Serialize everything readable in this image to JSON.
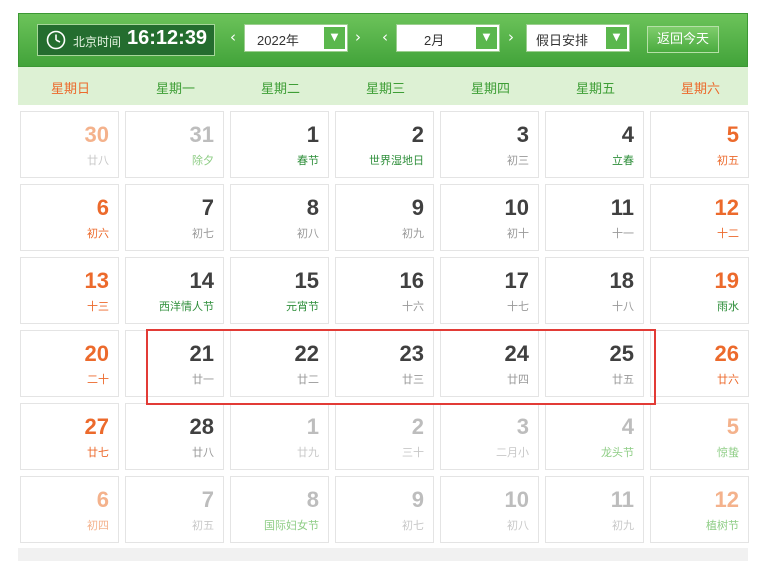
{
  "toolbar": {
    "clock_label": "北京时间",
    "time": "16:12:39",
    "prev_arrow": "‹",
    "next_arrow": "›",
    "year_value": "2022年",
    "month_value": "2月",
    "holiday_value": "假日安排",
    "dropdown_glyph": "▼",
    "today_button": "返回今天"
  },
  "weekdays": [
    "星期日",
    "星期一",
    "星期二",
    "星期三",
    "星期四",
    "星期五",
    "星期六"
  ],
  "colors": {
    "weekend": "#ec6a2c",
    "weekend_faded": "#f4b28c",
    "weekday": "#404040",
    "weekday_faded": "#bdbdbd",
    "lunar": "#999999",
    "lunar_faded": "#c8c8c8",
    "festival": "#2f8f3b",
    "festival_faded": "#8ecd85",
    "header_weekday": "#3e9e36",
    "header_weekend": "#ec6a2c"
  },
  "weeks": [
    [
      {
        "day": "30",
        "sub": "廿八",
        "type": "weekend",
        "kind": "lunar",
        "faded": true
      },
      {
        "day": "31",
        "sub": "除夕",
        "type": "weekday",
        "kind": "festival",
        "faded": true
      },
      {
        "day": "1",
        "sub": "春节",
        "type": "weekday",
        "kind": "festival",
        "faded": false
      },
      {
        "day": "2",
        "sub": "世界湿地日",
        "type": "weekday",
        "kind": "festival",
        "faded": false
      },
      {
        "day": "3",
        "sub": "初三",
        "type": "weekday",
        "kind": "lunar",
        "faded": false
      },
      {
        "day": "4",
        "sub": "立春",
        "type": "weekday",
        "kind": "festival",
        "faded": false
      },
      {
        "day": "5",
        "sub": "初五",
        "type": "weekend",
        "kind": "weekendsub",
        "faded": false
      }
    ],
    [
      {
        "day": "6",
        "sub": "初六",
        "type": "weekend",
        "kind": "weekendsub",
        "faded": false
      },
      {
        "day": "7",
        "sub": "初七",
        "type": "weekday",
        "kind": "lunar",
        "faded": false
      },
      {
        "day": "8",
        "sub": "初八",
        "type": "weekday",
        "kind": "lunar",
        "faded": false
      },
      {
        "day": "9",
        "sub": "初九",
        "type": "weekday",
        "kind": "lunar",
        "faded": false
      },
      {
        "day": "10",
        "sub": "初十",
        "type": "weekday",
        "kind": "lunar",
        "faded": false
      },
      {
        "day": "11",
        "sub": "十一",
        "type": "weekday",
        "kind": "lunar",
        "faded": false
      },
      {
        "day": "12",
        "sub": "十二",
        "type": "weekend",
        "kind": "weekendsub",
        "faded": false
      }
    ],
    [
      {
        "day": "13",
        "sub": "十三",
        "type": "weekend",
        "kind": "weekendsub",
        "faded": false
      },
      {
        "day": "14",
        "sub": "西洋情人节",
        "type": "weekday",
        "kind": "festival",
        "faded": false
      },
      {
        "day": "15",
        "sub": "元宵节",
        "type": "weekday",
        "kind": "festival",
        "faded": false
      },
      {
        "day": "16",
        "sub": "十六",
        "type": "weekday",
        "kind": "lunar",
        "faded": false
      },
      {
        "day": "17",
        "sub": "十七",
        "type": "weekday",
        "kind": "lunar",
        "faded": false
      },
      {
        "day": "18",
        "sub": "十八",
        "type": "weekday",
        "kind": "lunar",
        "faded": false
      },
      {
        "day": "19",
        "sub": "雨水",
        "type": "weekend",
        "kind": "festival",
        "faded": false
      }
    ],
    [
      {
        "day": "20",
        "sub": "二十",
        "type": "weekend",
        "kind": "weekendsub",
        "faded": false
      },
      {
        "day": "21",
        "sub": "廿一",
        "type": "weekday",
        "kind": "lunar",
        "faded": false
      },
      {
        "day": "22",
        "sub": "廿二",
        "type": "weekday",
        "kind": "lunar",
        "faded": false
      },
      {
        "day": "23",
        "sub": "廿三",
        "type": "weekday",
        "kind": "lunar",
        "faded": false
      },
      {
        "day": "24",
        "sub": "廿四",
        "type": "weekday",
        "kind": "lunar",
        "faded": false
      },
      {
        "day": "25",
        "sub": "廿五",
        "type": "weekday",
        "kind": "lunar",
        "faded": false
      },
      {
        "day": "26",
        "sub": "廿六",
        "type": "weekend",
        "kind": "weekendsub",
        "faded": false
      }
    ],
    [
      {
        "day": "27",
        "sub": "廿七",
        "type": "weekend",
        "kind": "weekendsub",
        "faded": false
      },
      {
        "day": "28",
        "sub": "廿八",
        "type": "weekday",
        "kind": "lunar",
        "faded": false
      },
      {
        "day": "1",
        "sub": "廿九",
        "type": "weekday",
        "kind": "lunar",
        "faded": true
      },
      {
        "day": "2",
        "sub": "三十",
        "type": "weekday",
        "kind": "lunar",
        "faded": true
      },
      {
        "day": "3",
        "sub": "二月小",
        "type": "weekday",
        "kind": "lunar",
        "faded": true
      },
      {
        "day": "4",
        "sub": "龙头节",
        "type": "weekday",
        "kind": "festival",
        "faded": true
      },
      {
        "day": "5",
        "sub": "惊蛰",
        "type": "weekend",
        "kind": "festival",
        "faded": true
      }
    ],
    [
      {
        "day": "6",
        "sub": "初四",
        "type": "weekend",
        "kind": "weekendsub",
        "faded": true
      },
      {
        "day": "7",
        "sub": "初五",
        "type": "weekday",
        "kind": "lunar",
        "faded": true
      },
      {
        "day": "8",
        "sub": "国际妇女节",
        "type": "weekday",
        "kind": "festival",
        "faded": true
      },
      {
        "day": "9",
        "sub": "初七",
        "type": "weekday",
        "kind": "lunar",
        "faded": true
      },
      {
        "day": "10",
        "sub": "初八",
        "type": "weekday",
        "kind": "lunar",
        "faded": true
      },
      {
        "day": "11",
        "sub": "初九",
        "type": "weekday",
        "kind": "lunar",
        "faded": true
      },
      {
        "day": "12",
        "sub": "植树节",
        "type": "weekend",
        "kind": "festival",
        "faded": true
      }
    ]
  ]
}
